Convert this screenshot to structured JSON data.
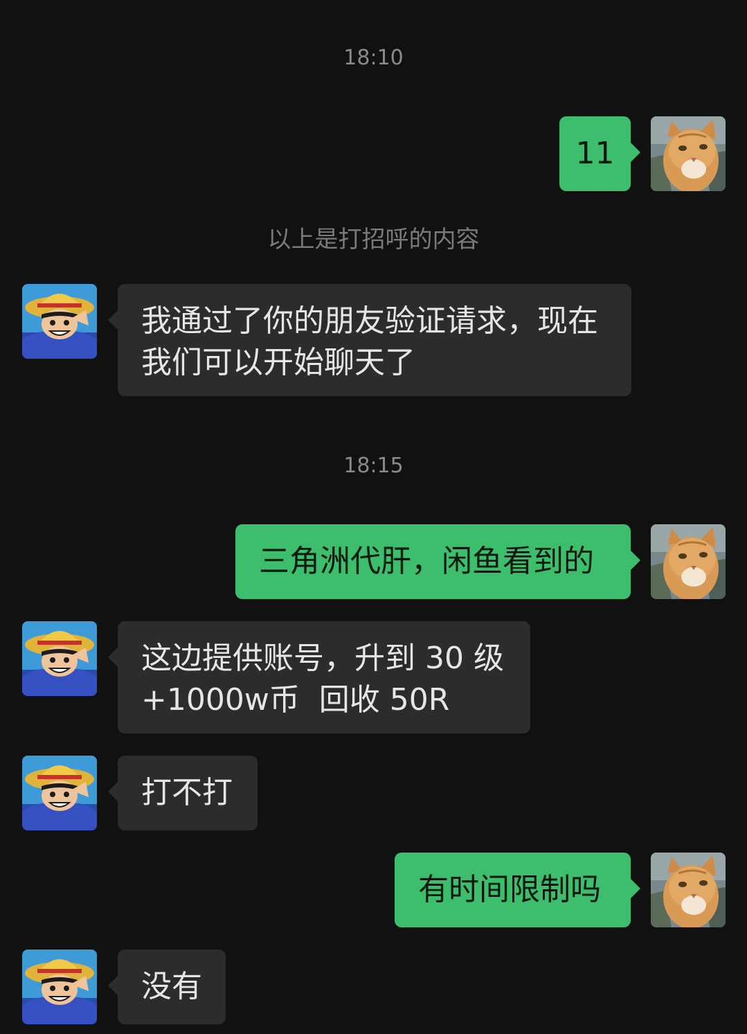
{
  "timestamps": [
    "18:10",
    "18:15"
  ],
  "system_notice": "以上是打招呼的内容",
  "avatars": {
    "self": {
      "icon": "cat-avatar-icon"
    },
    "contact": {
      "icon": "anime-character-avatar-icon"
    }
  },
  "messages": [
    {
      "from": "self",
      "text": "11"
    },
    {
      "from": "contact",
      "text": "我通过了你的朋友验证请求，现在我们可以开始聊天了"
    },
    {
      "from": "self",
      "text": "三角洲代肝，闲鱼看到的"
    },
    {
      "from": "contact",
      "text": "这边提供账号，升到 30 级 +1000w币  回收 50R"
    },
    {
      "from": "contact",
      "text": "打不打"
    },
    {
      "from": "self",
      "text": "有时间限制吗"
    },
    {
      "from": "contact",
      "text": "没有"
    }
  ],
  "colors": {
    "background": "#111111",
    "outgoing_bubble": "#3cbe6d",
    "incoming_bubble": "#2c2c2c",
    "incoming_text": "#e6e6e6",
    "timestamp_text": "#8a8a8a"
  }
}
